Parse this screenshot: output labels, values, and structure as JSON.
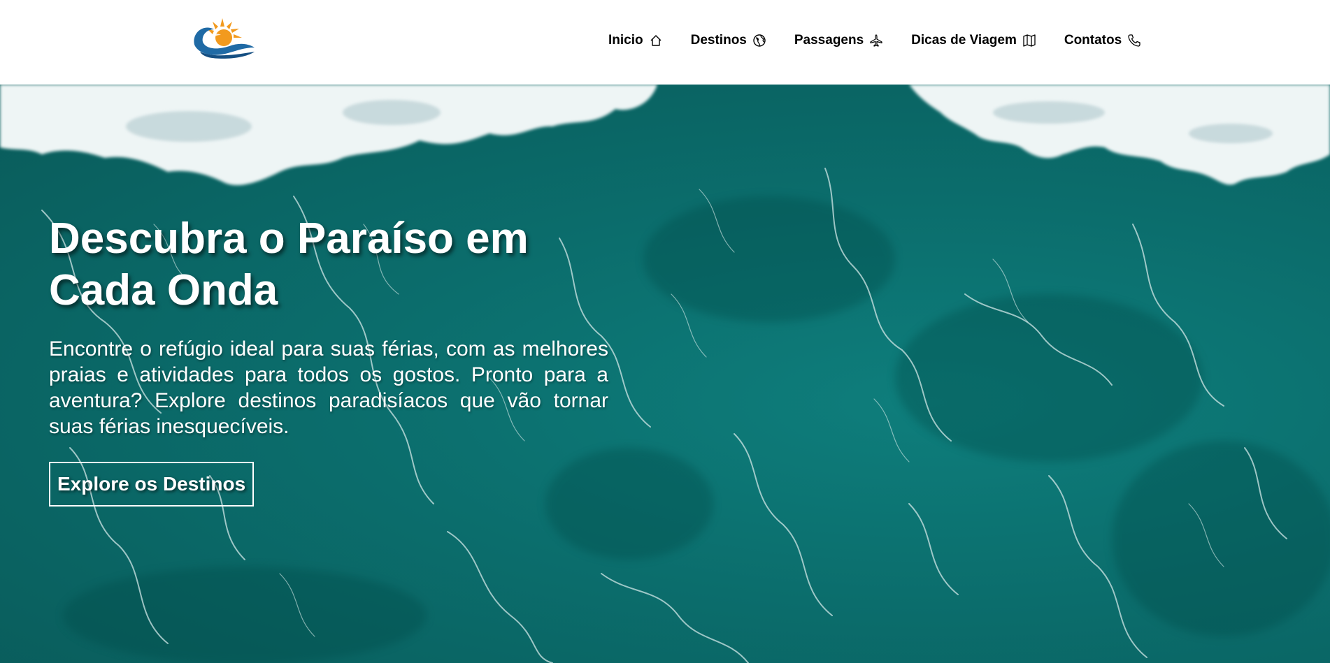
{
  "header": {
    "nav": [
      {
        "label": "Inicio",
        "icon": "home-icon"
      },
      {
        "label": "Destinos",
        "icon": "globe-icon"
      },
      {
        "label": "Passagens",
        "icon": "airplane-icon"
      },
      {
        "label": "Dicas de Viagem",
        "icon": "map-icon"
      },
      {
        "label": "Contatos",
        "icon": "phone-icon"
      }
    ]
  },
  "hero": {
    "title": "Descubra o Paraíso em Cada Onda",
    "text": "Encontre o refúgio ideal para suas férias, com as melhores praias e atividades para todos os gostos. Pronto para a aventura? Explore destinos paradisíacos que vão tornar suas férias inesquecíveis.",
    "button_label": "Explore os Destinos"
  },
  "colors": {
    "sea": "#0b6d6c",
    "foam": "#ffffff",
    "logo_blue": "#1f6aa5",
    "logo_sun": "#f29a1e",
    "text": "#000000"
  }
}
